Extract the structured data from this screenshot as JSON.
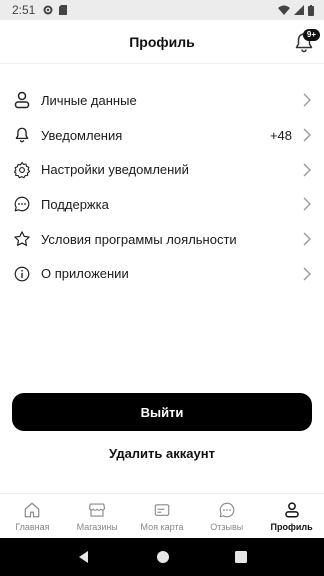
{
  "status_bar": {
    "time": "2:51"
  },
  "header": {
    "title": "Профиль",
    "notification_badge": "9+"
  },
  "menu": [
    {
      "label": "Личные данные",
      "icon": "person-icon"
    },
    {
      "label": "Уведомления",
      "icon": "bell-icon",
      "count": "+48"
    },
    {
      "label": "Настройки уведомлений",
      "icon": "gear-icon"
    },
    {
      "label": "Поддержка",
      "icon": "chat-bubble-icon"
    },
    {
      "label": "Условия программы лояльности",
      "icon": "star-icon"
    },
    {
      "label": "О приложении",
      "icon": "info-icon"
    }
  ],
  "actions": {
    "logout": "Выйти",
    "delete_account": "Удалить аккаунт"
  },
  "tabs": [
    {
      "label": "Главная",
      "icon": "home-icon"
    },
    {
      "label": "Магазины",
      "icon": "store-icon"
    },
    {
      "label": "Моя карта",
      "icon": "card-icon"
    },
    {
      "label": "Отзывы",
      "icon": "reviews-icon"
    },
    {
      "label": "Профиль",
      "icon": "profile-icon",
      "active": true
    }
  ],
  "colors": {
    "primary": "#000000",
    "status_bar_bg": "#ececec",
    "inactive_tab": "#888888"
  }
}
